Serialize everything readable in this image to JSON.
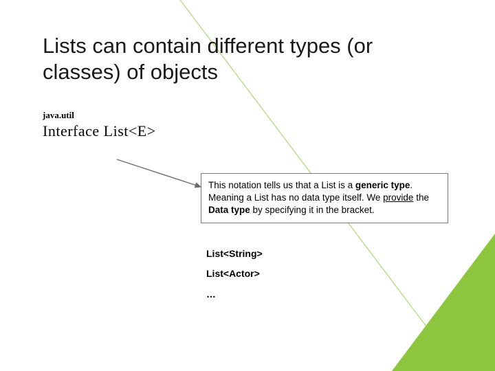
{
  "title": "Lists can contain different types (or classes) of objects",
  "package_label": "java.util",
  "interface_label": "Interface List<E>",
  "callout": {
    "part1": "This notation tells us that a List is a ",
    "bold1": "generic type",
    "part2": ". Meaning a List has no data type itself. We ",
    "underline1": "provide",
    "part3": " the ",
    "bold2": "Data type",
    "part4": " by specifying it in the bracket."
  },
  "examples": [
    "List<String>",
    "List<Actor>",
    "…"
  ]
}
